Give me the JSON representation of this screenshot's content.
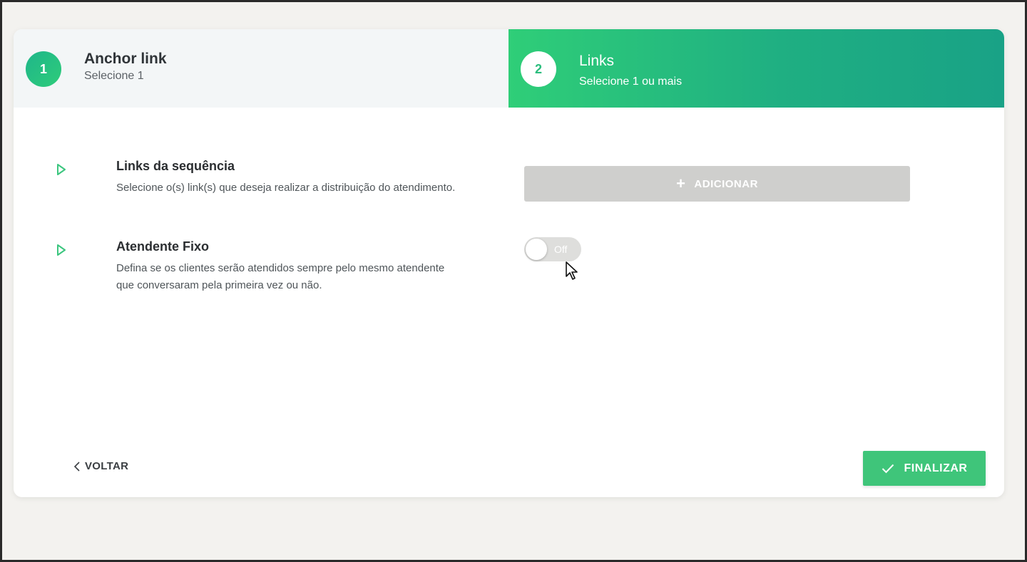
{
  "steps": [
    {
      "number": "1",
      "title": "Anchor link",
      "subtitle": "Selecione 1"
    },
    {
      "number": "2",
      "title": "Links",
      "subtitle": "Selecione 1 ou mais"
    }
  ],
  "settings": {
    "links": {
      "title": "Links da sequência",
      "description": "Selecione o(s) link(s) que deseja realizar a distribuição do atendimento.",
      "add_label": "ADICIONAR"
    },
    "fixed_agent": {
      "title": "Atendente Fixo",
      "description": "Defina se os clientes serão atendidos sempre pelo mesmo atendente que conversaram pela primeira vez ou não.",
      "toggle_label": "Off",
      "toggle_state": "off"
    }
  },
  "footer": {
    "back_label": "VOLTAR",
    "finish_label": "FINALIZAR"
  },
  "icons": {
    "row_arrow": "play-outline-icon",
    "add": "plus-icon",
    "back": "chevron-left-icon",
    "finish": "check-icon",
    "cursor": "mouse-pointer-icon"
  },
  "colors": {
    "accent": "#2fce78",
    "accent_dark": "#19a286",
    "disabled_button": "#cfcfcd",
    "toggle_off": "#dededc"
  }
}
